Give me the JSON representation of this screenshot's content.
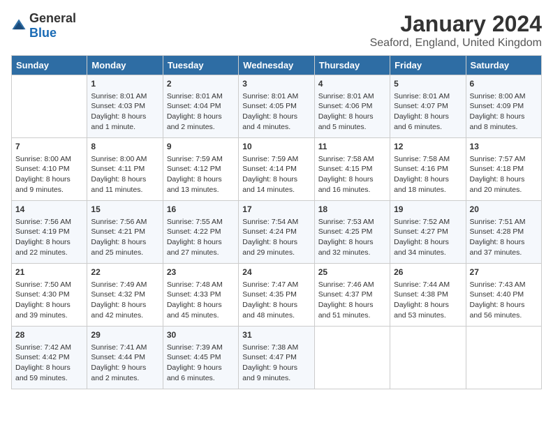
{
  "header": {
    "logo_general": "General",
    "logo_blue": "Blue",
    "month_year": "January 2024",
    "location": "Seaford, England, United Kingdom"
  },
  "days_of_week": [
    "Sunday",
    "Monday",
    "Tuesday",
    "Wednesday",
    "Thursday",
    "Friday",
    "Saturday"
  ],
  "weeks": [
    [
      {
        "day": "",
        "content": ""
      },
      {
        "day": "1",
        "content": "Sunrise: 8:01 AM\nSunset: 4:03 PM\nDaylight: 8 hours\nand 1 minute."
      },
      {
        "day": "2",
        "content": "Sunrise: 8:01 AM\nSunset: 4:04 PM\nDaylight: 8 hours\nand 2 minutes."
      },
      {
        "day": "3",
        "content": "Sunrise: 8:01 AM\nSunset: 4:05 PM\nDaylight: 8 hours\nand 4 minutes."
      },
      {
        "day": "4",
        "content": "Sunrise: 8:01 AM\nSunset: 4:06 PM\nDaylight: 8 hours\nand 5 minutes."
      },
      {
        "day": "5",
        "content": "Sunrise: 8:01 AM\nSunset: 4:07 PM\nDaylight: 8 hours\nand 6 minutes."
      },
      {
        "day": "6",
        "content": "Sunrise: 8:00 AM\nSunset: 4:09 PM\nDaylight: 8 hours\nand 8 minutes."
      }
    ],
    [
      {
        "day": "7",
        "content": "Sunrise: 8:00 AM\nSunset: 4:10 PM\nDaylight: 8 hours\nand 9 minutes."
      },
      {
        "day": "8",
        "content": "Sunrise: 8:00 AM\nSunset: 4:11 PM\nDaylight: 8 hours\nand 11 minutes."
      },
      {
        "day": "9",
        "content": "Sunrise: 7:59 AM\nSunset: 4:12 PM\nDaylight: 8 hours\nand 13 minutes."
      },
      {
        "day": "10",
        "content": "Sunrise: 7:59 AM\nSunset: 4:14 PM\nDaylight: 8 hours\nand 14 minutes."
      },
      {
        "day": "11",
        "content": "Sunrise: 7:58 AM\nSunset: 4:15 PM\nDaylight: 8 hours\nand 16 minutes."
      },
      {
        "day": "12",
        "content": "Sunrise: 7:58 AM\nSunset: 4:16 PM\nDaylight: 8 hours\nand 18 minutes."
      },
      {
        "day": "13",
        "content": "Sunrise: 7:57 AM\nSunset: 4:18 PM\nDaylight: 8 hours\nand 20 minutes."
      }
    ],
    [
      {
        "day": "14",
        "content": "Sunrise: 7:56 AM\nSunset: 4:19 PM\nDaylight: 8 hours\nand 22 minutes."
      },
      {
        "day": "15",
        "content": "Sunrise: 7:56 AM\nSunset: 4:21 PM\nDaylight: 8 hours\nand 25 minutes."
      },
      {
        "day": "16",
        "content": "Sunrise: 7:55 AM\nSunset: 4:22 PM\nDaylight: 8 hours\nand 27 minutes."
      },
      {
        "day": "17",
        "content": "Sunrise: 7:54 AM\nSunset: 4:24 PM\nDaylight: 8 hours\nand 29 minutes."
      },
      {
        "day": "18",
        "content": "Sunrise: 7:53 AM\nSunset: 4:25 PM\nDaylight: 8 hours\nand 32 minutes."
      },
      {
        "day": "19",
        "content": "Sunrise: 7:52 AM\nSunset: 4:27 PM\nDaylight: 8 hours\nand 34 minutes."
      },
      {
        "day": "20",
        "content": "Sunrise: 7:51 AM\nSunset: 4:28 PM\nDaylight: 8 hours\nand 37 minutes."
      }
    ],
    [
      {
        "day": "21",
        "content": "Sunrise: 7:50 AM\nSunset: 4:30 PM\nDaylight: 8 hours\nand 39 minutes."
      },
      {
        "day": "22",
        "content": "Sunrise: 7:49 AM\nSunset: 4:32 PM\nDaylight: 8 hours\nand 42 minutes."
      },
      {
        "day": "23",
        "content": "Sunrise: 7:48 AM\nSunset: 4:33 PM\nDaylight: 8 hours\nand 45 minutes."
      },
      {
        "day": "24",
        "content": "Sunrise: 7:47 AM\nSunset: 4:35 PM\nDaylight: 8 hours\nand 48 minutes."
      },
      {
        "day": "25",
        "content": "Sunrise: 7:46 AM\nSunset: 4:37 PM\nDaylight: 8 hours\nand 51 minutes."
      },
      {
        "day": "26",
        "content": "Sunrise: 7:44 AM\nSunset: 4:38 PM\nDaylight: 8 hours\nand 53 minutes."
      },
      {
        "day": "27",
        "content": "Sunrise: 7:43 AM\nSunset: 4:40 PM\nDaylight: 8 hours\nand 56 minutes."
      }
    ],
    [
      {
        "day": "28",
        "content": "Sunrise: 7:42 AM\nSunset: 4:42 PM\nDaylight: 8 hours\nand 59 minutes."
      },
      {
        "day": "29",
        "content": "Sunrise: 7:41 AM\nSunset: 4:44 PM\nDaylight: 9 hours\nand 2 minutes."
      },
      {
        "day": "30",
        "content": "Sunrise: 7:39 AM\nSunset: 4:45 PM\nDaylight: 9 hours\nand 6 minutes."
      },
      {
        "day": "31",
        "content": "Sunrise: 7:38 AM\nSunset: 4:47 PM\nDaylight: 9 hours\nand 9 minutes."
      },
      {
        "day": "",
        "content": ""
      },
      {
        "day": "",
        "content": ""
      },
      {
        "day": "",
        "content": ""
      }
    ]
  ]
}
